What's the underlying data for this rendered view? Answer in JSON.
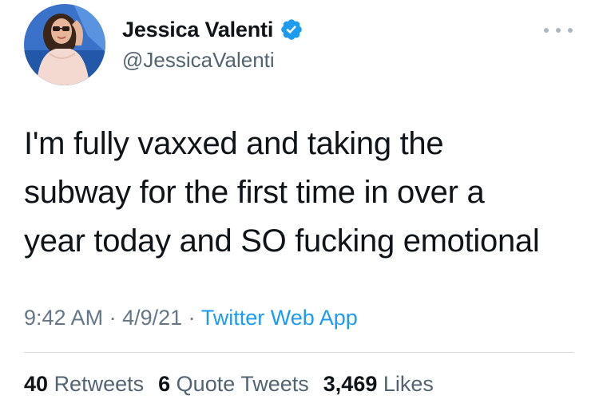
{
  "user": {
    "display_name": "Jessica Valenti",
    "handle": "@JessicaValenti",
    "verified_icon": "verified-badge-icon",
    "avatar_icon": "profile-photo"
  },
  "tweet": {
    "lines": [
      "I'm fully vaxxed and taking the",
      "subway for the first time in over a",
      "year today and SO fucking emotional"
    ]
  },
  "meta": {
    "time": "9:42 AM",
    "separator": "·",
    "date": "4/9/21",
    "source": "Twitter Web App"
  },
  "stats": {
    "retweets_count": "40",
    "retweets_label": "Retweets",
    "quotes_count": "6",
    "quotes_label": "Quote Tweets",
    "likes_count": "3,469",
    "likes_label": "Likes"
  },
  "colors": {
    "link_blue": "#1d9bf0",
    "muted_gray": "#536471",
    "text": "#0f1419"
  }
}
